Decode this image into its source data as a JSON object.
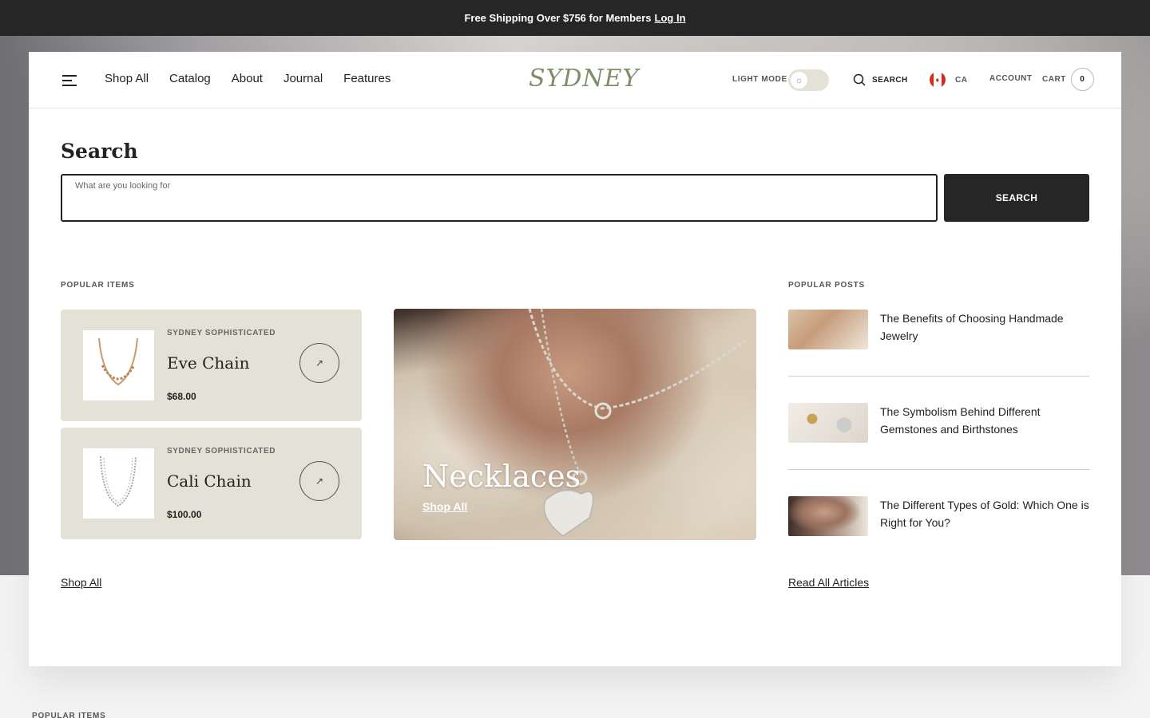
{
  "announcement": {
    "text": "Free Shipping Over $756 for Members",
    "login_label": "Log In"
  },
  "header": {
    "nav": [
      "Shop All",
      "Catalog",
      "About",
      "Journal",
      "Features"
    ],
    "logo": "SYDNEY",
    "light_mode_label": "LIGHT MODE",
    "search_label": "SEARCH",
    "country_code": "CA",
    "account_label": "ACCOUNT",
    "cart_label": "CART",
    "cart_count": "0"
  },
  "search": {
    "title": "Search",
    "placeholder": "What are you looking for",
    "button_label": "SEARCH"
  },
  "popular_items": {
    "label": "POPULAR ITEMS",
    "items": [
      {
        "brand": "SYDNEY SOPHISTICATED",
        "name": "Eve Chain",
        "price": "$68.00",
        "arrow": "↗"
      },
      {
        "brand": "SYDNEY SOPHISTICATED",
        "name": "Cali Chain",
        "price": "$100.00",
        "arrow": "↗"
      }
    ],
    "shop_all": "Shop All"
  },
  "feature": {
    "title": "Necklaces",
    "link": "Shop All"
  },
  "popular_posts": {
    "label": "POPULAR POSTS",
    "posts": [
      {
        "title": "The Benefits of Choosing Handmade Jewelry"
      },
      {
        "title": "The Symbolism Behind Different Gemstones and Birthstones"
      },
      {
        "title": "The Different Types of Gold: Which One is Right for You?"
      }
    ],
    "read_all": "Read All Articles"
  },
  "below_fold_label": "POPULAR ITEMS",
  "colors": {
    "accent_logo": "#7f8e66",
    "dark": "#262626",
    "card_bg": "#e4e1d6"
  }
}
